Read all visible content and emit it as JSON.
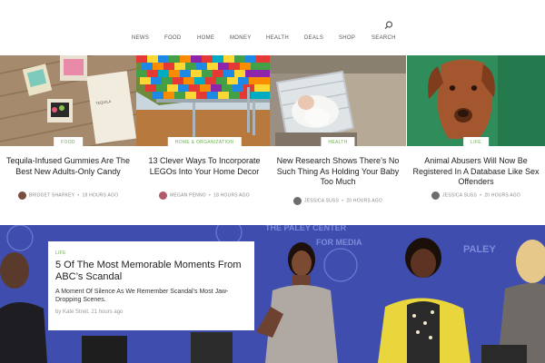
{
  "nav": {
    "items": [
      "NEWS",
      "FOOD",
      "HOME",
      "MONEY",
      "HEALTH",
      "DEALS",
      "SHOP",
      "SEARCH"
    ],
    "search_icon": "search-icon"
  },
  "cards": [
    {
      "category": "FOOD",
      "title": "Tequila-Infused Gummies Are The Best New Adults-Only Candy",
      "author": "BRIDGET SHARKEY",
      "time": "18 HOURS AGO"
    },
    {
      "category": "HOME & ORGANIZATION",
      "title": "13 Clever Ways To Incorporate LEGOs Into Your Home Decor",
      "author": "MEGAN PENNO",
      "time": "18 HOURS AGO"
    },
    {
      "category": "HEALTH",
      "title": "New Research Shows There’s No Such Thing As Holding Your Baby Too Much",
      "author": "JESSICA SUSS",
      "time": "20 HOURS AGO"
    },
    {
      "category": "LIFE",
      "title": "Animal Abusers Will Now Be Registered In A Database Like Sex Offenders",
      "author": "JESSICA SUSS",
      "time": "20 HOURS AGO"
    }
  ],
  "hero": {
    "category": "LIFE",
    "title": "5 Of The Most Memorable Moments From ABC’s Scandal",
    "subtitle": "A Moment Of Silence As We Remember Scandal’s Most Jaw-Dropping Scenes.",
    "meta": "by Kate Streit, 21 hours ago",
    "backdrop_text": [
      "THE PALEY CENTER",
      "FOR MEDIA",
      "PALEY"
    ]
  },
  "colors": {
    "category": "#6ab04c",
    "hero_bg": "#3a47a8"
  }
}
